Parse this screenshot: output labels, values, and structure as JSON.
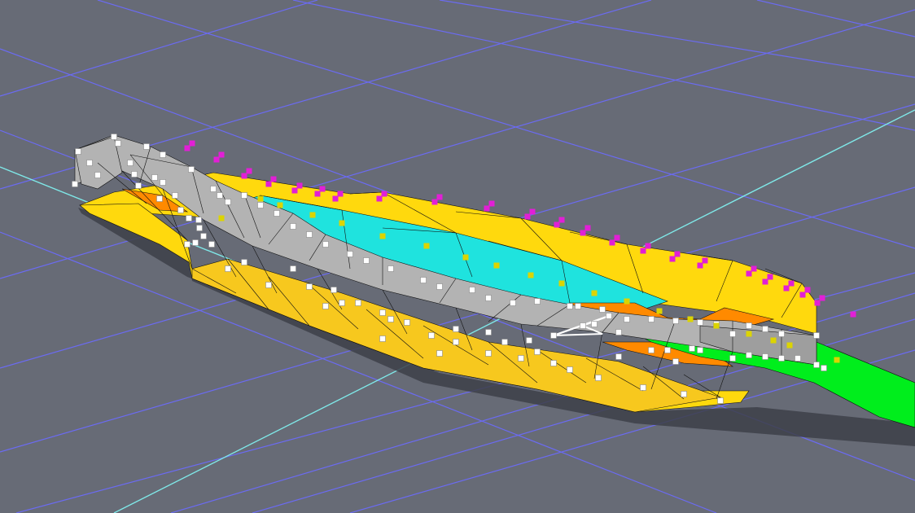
{
  "viewport": {
    "background_color": "#676b76",
    "grid_color": "#6b6bf2",
    "axis_color": "#7fe8e8"
  },
  "mesh": {
    "deck_color": "#b3b3b3",
    "hull_color": "#ffd90d",
    "hull_side_color": "#f7c81e",
    "inner_water_color": "#1fe3de",
    "orange_color": "#ff8a00",
    "green_color": "#00ee1c",
    "edge_color": "#111111",
    "shadow_color": "#3d4049",
    "vertex_color": "#ffffff",
    "marker_yellow_color": "#dcd400",
    "marker_magenta_color": "#e21fd6"
  }
}
